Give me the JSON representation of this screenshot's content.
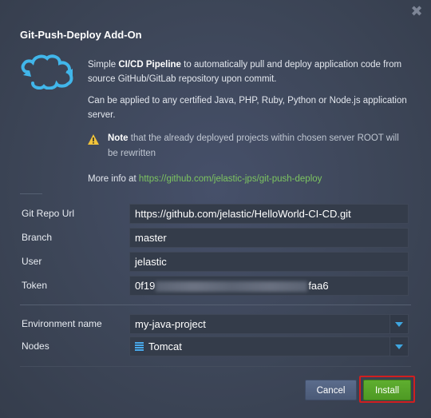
{
  "dialog": {
    "title": "Git-Push-Deploy Add-On",
    "close_glyph": "✖"
  },
  "description": {
    "line1_pre": "Simple ",
    "line1_bold": "CI/CD Pipeline",
    "line1_post": " to automatically pull and deploy application code from source GitHub/GitLab repository upon commit.",
    "line2": "Can be applied to any certified Java, PHP, Ruby, Python or Node.js application server."
  },
  "note": {
    "bold": "Note",
    "text": " that the already deployed projects within chosen server ROOT will be rewritten"
  },
  "more_info": {
    "label": "More info at ",
    "link": "https://github.com/jelastic-jps/git-push-deploy"
  },
  "form": {
    "repo_label": "Git Repo Url",
    "repo_value": "https://github.com/jelastic/HelloWorld-CI-CD.git",
    "branch_label": "Branch",
    "branch_value": "master",
    "user_label": "User",
    "user_value": "jelastic",
    "token_label": "Token",
    "token_prefix": "0f19",
    "token_suffix": "faa6",
    "env_label": "Environment name",
    "env_value": "my-java-project",
    "nodes_label": "Nodes",
    "nodes_value": "Tomcat"
  },
  "buttons": {
    "cancel": "Cancel",
    "install": "Install"
  },
  "colors": {
    "accent_link": "#7dc560",
    "install_green": "#5fae2f",
    "highlight_red": "#d11f1f",
    "dropdown_arrow": "#3fa6e0"
  },
  "icons": {
    "logo": "cloud-sync-icon",
    "warning": "warning-icon",
    "close": "close-icon",
    "node": "tomcat-icon"
  }
}
